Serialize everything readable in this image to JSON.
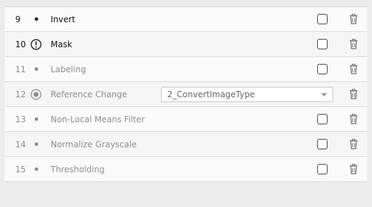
{
  "steps": [
    {
      "number": "9",
      "label": "Invert",
      "status_icon": "bullet-dot-icon",
      "enabled": true,
      "control": "checkbox"
    },
    {
      "number": "10",
      "label": "Mask",
      "status_icon": "exclamation-circle-icon",
      "enabled": true,
      "control": "checkbox"
    },
    {
      "number": "11",
      "label": "Labeling",
      "status_icon": "bullet-dot-icon",
      "enabled": false,
      "control": "checkbox"
    },
    {
      "number": "12",
      "label": "Reference Change",
      "status_icon": "target-circle-icon",
      "enabled": false,
      "control": "select",
      "select_value": "2_ConvertImageType"
    },
    {
      "number": "13",
      "label": "Non-Local Means Filter",
      "status_icon": "bullet-dot-icon",
      "enabled": false,
      "control": "checkbox"
    },
    {
      "number": "14",
      "label": "Normalize Grayscale",
      "status_icon": "bullet-dot-icon",
      "enabled": false,
      "control": "checkbox"
    },
    {
      "number": "15",
      "label": "Thresholding",
      "status_icon": "bullet-dot-icon",
      "enabled": false,
      "control": "checkbox"
    }
  ],
  "colors": {
    "row_background": "#f5f5f5",
    "enabled_text": "#111111",
    "disabled_text": "#8e8e8e",
    "border": "#d9d9d9"
  }
}
